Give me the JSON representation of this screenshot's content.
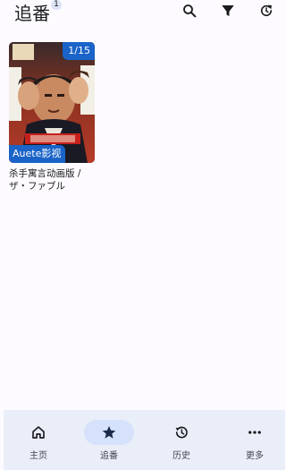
{
  "header": {
    "title": "追番",
    "badge_count": "1",
    "actions": [
      {
        "name": "search-icon"
      },
      {
        "name": "filter-icon"
      },
      {
        "name": "refresh-icon"
      }
    ]
  },
  "cards": [
    {
      "episode": "1/15",
      "source": "Auete影视",
      "title": "杀手寓言动画版 / ザ・ファブル"
    }
  ],
  "nav": {
    "items": [
      {
        "label": "主页",
        "icon": "home-icon",
        "active": false
      },
      {
        "label": "追番",
        "icon": "star-icon",
        "active": true
      },
      {
        "label": "历史",
        "icon": "history-icon",
        "active": false
      },
      {
        "label": "更多",
        "icon": "more-icon",
        "active": false
      }
    ]
  },
  "colors": {
    "accent": "#1a63c8",
    "nav_bg": "#eaeef9",
    "nav_active": "#d6e2fb",
    "page_bg": "#fdfbff"
  }
}
